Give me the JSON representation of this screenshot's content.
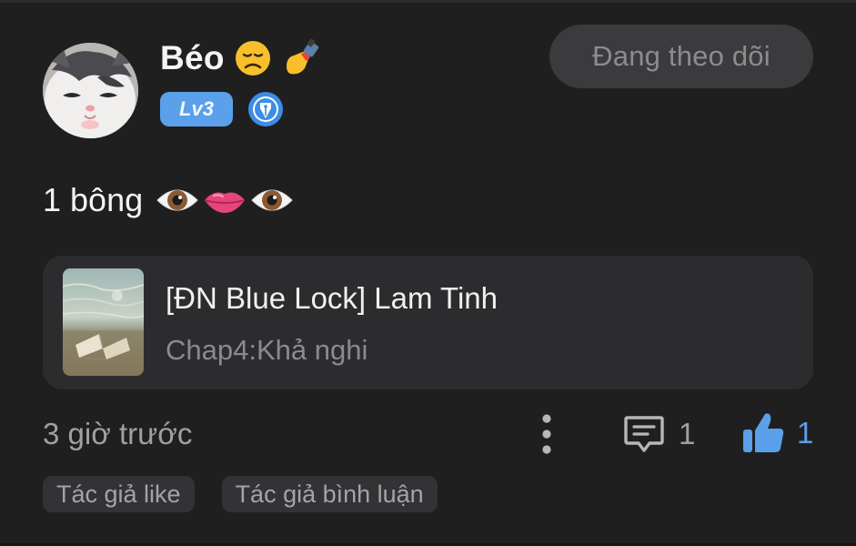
{
  "post": {
    "username": "Béo",
    "username_emojis": [
      "disappointed-face-icon",
      "nail-polish-icon"
    ],
    "level_badge": "Lv3",
    "author_badge_icon": "pen-nib-icon",
    "follow_label": "Đang theo dõi",
    "content_text": "1 bông",
    "content_emojis": [
      "eye-icon",
      "mouth-icon",
      "eye-icon"
    ]
  },
  "story": {
    "title": "[ĐN Blue Lock] Lam Tinh",
    "chapter": "Chap4:Khả nghi"
  },
  "footer": {
    "timestamp": "3 giờ trước",
    "comment_count": "1",
    "like_count": "1",
    "accent_color": "#5aa0ea"
  },
  "tags": [
    "Tác giả like",
    "Tác giả bình luận"
  ]
}
